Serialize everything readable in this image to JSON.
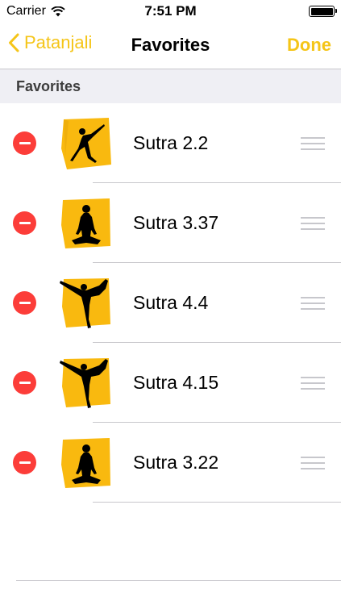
{
  "status_bar": {
    "carrier": "Carrier",
    "time": "7:51 PM",
    "wifi_icon": "wifi-icon",
    "battery_icon": "battery-icon"
  },
  "nav": {
    "back_label": "Patanjali",
    "title": "Favorites",
    "done_label": "Done",
    "accent_color": "#f5c518"
  },
  "section": {
    "header": "Favorites"
  },
  "favorites": [
    {
      "label": "Sutra 2.2",
      "pose": "triangle-pose-icon"
    },
    {
      "label": "Sutra 3.37",
      "pose": "lotus-pose-icon"
    },
    {
      "label": "Sutra 4.4",
      "pose": "dancer-pose-icon"
    },
    {
      "label": "Sutra 4.15",
      "pose": "dancer-pose-icon"
    },
    {
      "label": "Sutra 3.22",
      "pose": "lotus-pose-icon"
    }
  ],
  "colors": {
    "delete": "#fc3d39",
    "thumb_bg": "#f9b90f",
    "separator": "#c8c7cc"
  }
}
